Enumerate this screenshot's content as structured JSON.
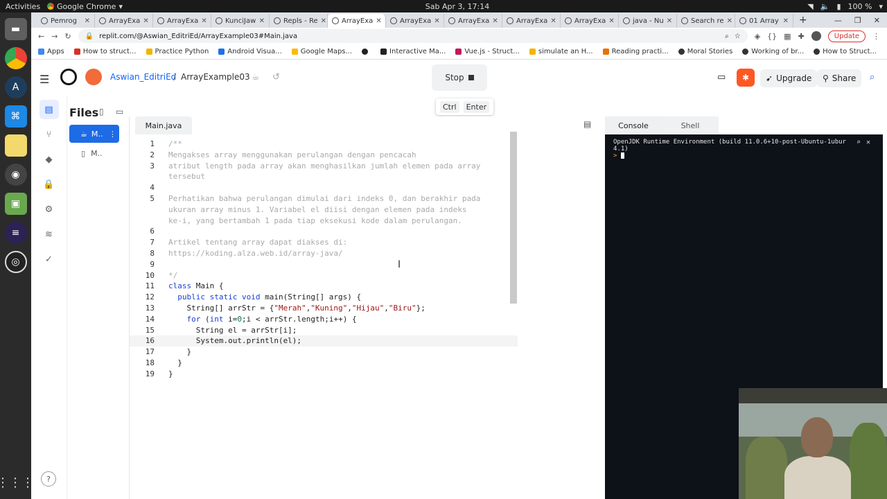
{
  "os": {
    "activities": "Activities",
    "browser_name": "Google Chrome",
    "clock": "Sab Apr 3, 17:14",
    "battery": "100 %"
  },
  "tabs": [
    {
      "label": "Pemrog"
    },
    {
      "label": "ArrayExa"
    },
    {
      "label": "ArrayExa"
    },
    {
      "label": "KunciJaw"
    },
    {
      "label": "Repls - Re"
    },
    {
      "label": "ArrayExa",
      "active": true
    },
    {
      "label": "ArrayExa"
    },
    {
      "label": "ArrayExa"
    },
    {
      "label": "ArrayExa"
    },
    {
      "label": "ArrayExa"
    },
    {
      "label": "java - Nu"
    },
    {
      "label": "Search re"
    },
    {
      "label": "01 Array"
    }
  ],
  "address": {
    "url": "replit.com/@Aswian_EditriEd/ArrayExample03#Main.java",
    "update_label": "Update"
  },
  "bookmarks": [
    {
      "label": "Apps",
      "color": "#4285f4"
    },
    {
      "label": "How to struct...",
      "color": "#d93025"
    },
    {
      "label": "Practice Python",
      "color": "#f4b400"
    },
    {
      "label": "Android Visua...",
      "color": "#1a73e8"
    },
    {
      "label": "Google Maps...",
      "color": "#fbbc04"
    },
    {
      "label": "",
      "color": "#222"
    },
    {
      "label": "Interactive Ma...",
      "color": "#222"
    },
    {
      "label": "Vue.js - Struct...",
      "color": "#c2185b"
    },
    {
      "label": "simulate an H...",
      "color": "#f4b400"
    },
    {
      "label": "Reading practi...",
      "color": "#e8710a"
    },
    {
      "label": "Moral Stories",
      "color": "#333"
    },
    {
      "label": "Working of br...",
      "color": "#333"
    },
    {
      "label": "How to Struct...",
      "color": "#333"
    }
  ],
  "header": {
    "user": "Aswian_EditriEd",
    "separator": "/",
    "repl_name": "ArrayExample03",
    "stop_label": "Stop",
    "shortcut_ctrl": "Ctrl",
    "shortcut_enter": "Enter",
    "upgrade_label": "Upgrade",
    "share_label": "Share"
  },
  "files": {
    "title": "Files",
    "item1": "M..",
    "item2": "M.."
  },
  "editor": {
    "tab_label": "Main.java",
    "line_numbers": [
      "1",
      "2",
      "3",
      "",
      "4",
      "5",
      "",
      "",
      "6",
      "7",
      "8",
      "9",
      "10",
      "11",
      "12",
      "13",
      "14",
      "15",
      "16",
      "17",
      "18",
      "19"
    ],
    "lines": [
      {
        "t": "/**",
        "c": "cm"
      },
      {
        "t": "Mengakses array menggunakan perulangan dengan pencacah",
        "c": "cm"
      },
      {
        "t": "atribut length pada array akan menghasilkan jumlah elemen pada array",
        "c": "cm"
      },
      {
        "t": "tersebut",
        "c": "cm"
      },
      {
        "t": "",
        "c": "cm"
      },
      {
        "t": "Perhatikan bahwa perulangan dimulai dari indeks 0, dan berakhir pada",
        "c": "cm"
      },
      {
        "t": "ukuran array minus 1. Variabel el diisi dengan elemen pada indeks",
        "c": "cm"
      },
      {
        "t": "ke-i, yang bertambah 1 pada tiap eksekusi kode dalam perulangan.",
        "c": "cm"
      },
      {
        "t": "",
        "c": "cm"
      },
      {
        "t": "Artikel tentang array dapat diakses di:",
        "c": "cm"
      },
      {
        "t": "https://koding.alza.web.id/array-java/",
        "c": "cm"
      },
      {
        "t": "",
        "c": "cm"
      },
      {
        "t": "*/",
        "c": "cm"
      }
    ]
  },
  "console": {
    "tab_console": "Console",
    "tab_shell": "Shell",
    "output_line1": "OpenJDK Runtime Environment (build 11.0.6+10-post-Ubuntu-1ubur",
    "output_line2": "4.1)",
    "prompt": ">"
  }
}
